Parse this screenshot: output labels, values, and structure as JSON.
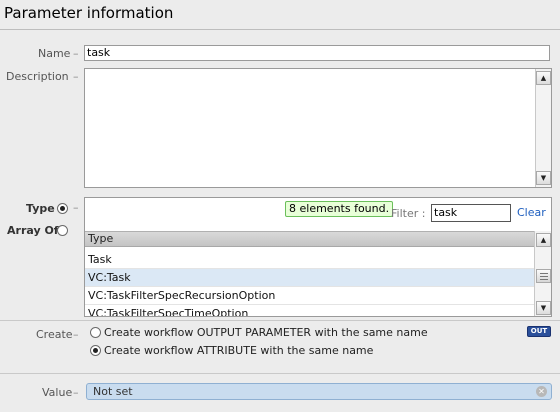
{
  "title": "Parameter information",
  "name": {
    "label": "Name",
    "value": "task"
  },
  "description": {
    "label": "Description",
    "value": ""
  },
  "type_radio": {
    "label": "Type"
  },
  "array_radio": {
    "label": "Array Of"
  },
  "type_picker": {
    "found_text": "8 elements found.",
    "filter_label": "Filter :",
    "filter_value": "task",
    "clear_label": "Clear",
    "column_header": "Type",
    "rows": [
      "Task",
      "VC:Task",
      "VC:TaskFilterSpecRecursionOption",
      "VC:TaskFilterSpecTimeOption"
    ]
  },
  "create": {
    "label": "Create",
    "option_output": "Create workflow OUTPUT PARAMETER with the same name",
    "option_attribute": "Create workflow ATTRIBUTE with the same name",
    "out_badge": "OUT"
  },
  "value": {
    "label": "Value",
    "text": "Not set"
  },
  "colors": {
    "selected_row": "#dbe8f5",
    "value_bg": "#c9dcef",
    "link": "#1f5fbf",
    "found_bg": "#e8ffd8"
  }
}
